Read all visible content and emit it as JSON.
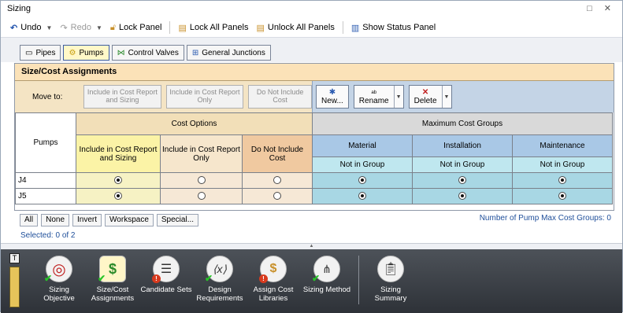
{
  "window": {
    "title": "Sizing",
    "buttons": "□ ✕"
  },
  "toolbar": {
    "undo": "Undo",
    "redo": "Redo",
    "lock_panel": "Lock Panel",
    "lock_all": "Lock All Panels",
    "unlock_all": "Unlock All Panels",
    "status_panel": "Show Status Panel"
  },
  "tabs": [
    {
      "label": "Pipes",
      "active": false
    },
    {
      "label": "Pumps",
      "active": true
    },
    {
      "label": "Control Valves",
      "active": false
    },
    {
      "label": "General Junctions",
      "active": false
    }
  ],
  "panel": {
    "title": "Size/Cost Assignments",
    "move_to": "Move to:",
    "move_buttons": [
      "Include in Cost Report and Sizing",
      "Include in Cost Report Only",
      "Do Not Include Cost"
    ],
    "new_label": "New...",
    "rename_label": "Rename",
    "delete_label": "Delete"
  },
  "grid": {
    "row_header": "Pumps",
    "cost_options_title": "Cost Options",
    "max_groups_title": "Maximum Cost Groups",
    "cost_columns": [
      "Include in Cost Report and Sizing",
      "Include in Cost Report Only",
      "Do Not Include Cost"
    ],
    "group_columns": [
      "Material",
      "Installation",
      "Maintenance"
    ],
    "group_values": [
      "Not in Group",
      "Not in Group",
      "Not in Group"
    ],
    "rows": [
      {
        "name": "J4",
        "cost_choice": 0,
        "groups": [
          true,
          true,
          true
        ]
      },
      {
        "name": "J5",
        "cost_choice": 0,
        "groups": [
          true,
          true,
          true
        ]
      }
    ]
  },
  "selection": {
    "buttons": [
      "All",
      "None",
      "Invert",
      "Workspace",
      "Special..."
    ],
    "selected_text": "Selected: 0 of 2",
    "max_groups_text": "Number of Pump Max Cost Groups: 0"
  },
  "dock": {
    "pin": "T",
    "items": [
      {
        "label": "Sizing Objective",
        "icon": "target-icon",
        "status": "ok"
      },
      {
        "label": "Size/Cost Assignments",
        "icon": "money-icon",
        "status": "ok"
      },
      {
        "label": "Candidate Sets",
        "icon": "list-icon",
        "status": "error"
      },
      {
        "label": "Design Requirements",
        "icon": "variable-icon",
        "status": "ok"
      },
      {
        "label": "Assign Cost Libraries",
        "icon": "cost-library-icon",
        "status": "error"
      },
      {
        "label": "Sizing Method",
        "icon": "flowchart-icon",
        "status": "ok"
      },
      {
        "label": "Sizing Summary",
        "icon": "clipboard-icon",
        "status": "none"
      }
    ]
  }
}
